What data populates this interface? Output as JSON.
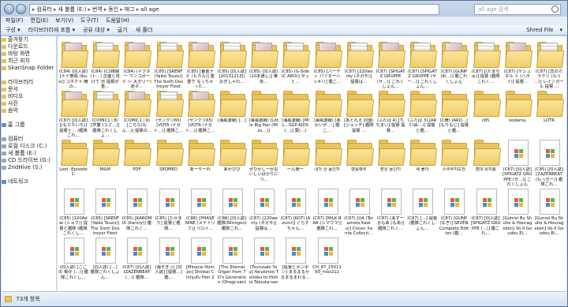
{
  "window": {
    "breadcrumb": [
      "컴퓨터",
      "새 볼륨 (E:)",
      "번역",
      "동인",
      "매그",
      "all age"
    ],
    "search_placeholder": "all age 검색"
  },
  "menu": [
    "파일(F)",
    "편집(E)",
    "보기(V)",
    "도구(T)",
    "도움말(H)"
  ],
  "toolbar": {
    "items": [
      "구성 ▾",
      "라이브러리에 포함 ▾",
      "공유 대상 ▾",
      "굽기",
      "새 폴더"
    ],
    "shred": "Shred File",
    "view": "▾"
  },
  "nav": [
    {
      "label": "즐겨찾기",
      "icon": "star"
    },
    {
      "label": "다운로드",
      "icon": "folder"
    },
    {
      "label": "바탕 화면",
      "icon": "folder"
    },
    {
      "label": "최근 위치",
      "icon": "folder"
    },
    {
      "label": "SkanSnap Folder",
      "icon": "folder"
    },
    {
      "label": "",
      "icon": ""
    },
    {
      "label": "라이브러리",
      "icon": "folder"
    },
    {
      "label": "문서",
      "icon": "folder"
    },
    {
      "label": "비디오",
      "icon": "folder"
    },
    {
      "label": "사진",
      "icon": "folder"
    },
    {
      "label": "음악",
      "icon": "folder"
    },
    {
      "label": "",
      "icon": ""
    },
    {
      "label": "홈 그룹",
      "icon": "net"
    },
    {
      "label": "",
      "icon": ""
    },
    {
      "label": "컴퓨터",
      "icon": "drive"
    },
    {
      "label": "로컬 디스크 (C:)",
      "icon": "drive"
    },
    {
      "label": "새 볼륨 (E:)",
      "icon": "drive"
    },
    {
      "label": "CD 드라이브 (G:)",
      "icon": "drive"
    },
    {
      "label": "2ndHive (S:)",
      "icon": "drive"
    },
    {
      "label": "",
      "icon": ""
    },
    {
      "label": "네트워크",
      "icon": "net"
    }
  ],
  "files": [
    {
      "name": "(C84) (同人誌) [ナイ巻情 (Ikue)] コネクト-俺の…",
      "kind": "folder",
      "paper": "tone"
    },
    {
      "name": "(C84) (C2楼閣 (ト…) 正面と背けて 日 提督が重…",
      "kind": "folder",
      "paper": "ink"
    },
    {
      "name": "(C84) (ドクター ウンコボーイ 〜 大ガリー) 迷子…",
      "kind": "folder",
      "paper": "tone"
    },
    {
      "name": "(C85) [SRENF (Yaikó Tsuzu)] The Sixth Destroyer Fleet",
      "kind": "folder",
      "paper": "ink"
    },
    {
      "name": "(C85) [番重ナビ (ヒカル)] 重重で なっちゃった…",
      "kind": "folder",
      "paper": "tone"
    },
    {
      "name": "(C85) [同人誌] [2013121日] おぎしゃれ…",
      "kind": "folder",
      "paper": "ink"
    },
    {
      "name": "(C85) (同人誌) (10本通し)] 東京…",
      "kind": "folder",
      "paper": "tone"
    },
    {
      "name": "(C85) (G-Side (C ARO)] ダッと…",
      "kind": "folder",
      "paper": "ink"
    },
    {
      "name": "(C85) [パーティ バツターハ ッキリ] 艦こ…",
      "kind": "folder",
      "paper": "tone"
    },
    {
      "name": "(C87) [220wenty (ネガモ)] 提督は…",
      "kind": "folder",
      "paper": "ink"
    },
    {
      "name": "(C87) [SPIGATZ GRUPPE (サ…)] これくしょん…",
      "kind": "folder",
      "paper": "tone"
    },
    {
      "name": "(C87) [SPIGATZ GRUPPE (サー…)] これくしょん…",
      "kind": "folder",
      "paper": "ink"
    },
    {
      "name": "(C87) [GUNP (Ki…)] 艦これくしょん",
      "kind": "folder",
      "paper": "tone"
    },
    {
      "name": "(C87) [(たまちゅ)] 提督 (艦隊これく…",
      "kind": "folder",
      "paper": "ink"
    },
    {
      "name": "(C87) [ゲシュタル ト (ハネイ)] 提督…",
      "kind": "folder",
      "paper": "tone"
    },
    {
      "name": "(C87) [恋のカラクリ (ルリ …)] レインガール 提督 …",
      "kind": "folder",
      "paper": "ink"
    },
    {
      "name": "(C87) [同人誌] [(もりたいち)] 提督と… (艦隊これ…",
      "kind": "folder",
      "paper": "tone"
    },
    {
      "name": "(COMIC1☆8) [学童 (ユズ…)] 艦隊これくしょ…",
      "kind": "folder",
      "paper": "ink"
    },
    {
      "name": "(COMIC1☆9) [こちら(もん…)] 提督の…",
      "kind": "folder",
      "paper": "tone"
    },
    {
      "name": "(サンクリ65) [VOTA (ナガト…)] 艦隊こ…",
      "kind": "folder",
      "paper": "ink"
    },
    {
      "name": "(サンクリ65) [VOTA (ナガト…)] 艦隊こ…",
      "kind": "folder",
      "paper": "tone"
    },
    {
      "name": "(海風激戦) […]",
      "kind": "folder",
      "paper": "none"
    },
    {
      "name": "(海風激戦) [Little Big Pair (Mizu…)]",
      "kind": "folder",
      "paper": "none"
    },
    {
      "name": "(海風激戦) [MIL…SGP-KIDS (…)] 愛(…)",
      "kind": "folder",
      "paper": "none"
    },
    {
      "name": "(海風激戦) [あかいが …] 艦こ…",
      "kind": "folder",
      "paper": "none"
    },
    {
      "name": "(あとれえ 同盟) [ジョッチ] 艦隊 提督 …",
      "kind": "folder",
      "paper": "none"
    },
    {
      "name": "(ふたば 4) [ちちまい] 提督 提督…",
      "kind": "folder",
      "paper": "none"
    },
    {
      "name": "(ふたば 3) [ARC(ぬ…)] 提督と艦…",
      "kind": "folder",
      "paper": "none"
    },
    {
      "name": "(C様) (ARO…) [もりもじ] 提督と艦…",
      "kind": "folder",
      "paper": "none"
    },
    {
      "name": "c85",
      "kind": "folder",
      "paper": "none"
    },
    {
      "name": "kodama",
      "kind": "folder",
      "paper": "none"
    },
    {
      "name": "LOTR",
      "kind": "folder",
      "paper": "none"
    },
    {
      "name": "Loot -Episode1-",
      "kind": "folder",
      "paper": "none"
    },
    {
      "name": "M&M",
      "kind": "folder",
      "paper": "none"
    },
    {
      "name": "PDF",
      "kind": "folder",
      "paper": "none"
    },
    {
      "name": "SEQMED",
      "kind": "folder",
      "paper": "none"
    },
    {
      "name": "あーやーれ",
      "kind": "folder",
      "paper": "none"
    },
    {
      "name": "あかびび",
      "kind": "folder",
      "paper": "none"
    },
    {
      "name": "ぜひかしーがおいしいばかりにつ…",
      "kind": "folder",
      "paper": "none"
    },
    {
      "name": "ーん使ー",
      "kind": "folder",
      "paper": "none"
    },
    {
      "name": "내가 산 동인지",
      "kind": "folder",
      "paper": "none"
    },
    {
      "name": "영웅해루",
      "kind": "folder",
      "paper": "none"
    },
    {
      "name": "받은 동인지",
      "kind": "folder",
      "paper": "none"
    },
    {
      "name": "새 폴더",
      "kind": "folder",
      "paper": "none"
    },
    {
      "name": "스쿠루지도전",
      "kind": "folder",
      "paper": "none"
    },
    {
      "name": "점대 유지됨",
      "kind": "folder",
      "paper": "none"
    },
    {
      "name": "(C87) [同人誌] [SPIGATZ GRUPPE (サ…)] これくしょん",
      "kind": "file"
    },
    {
      "name": "(C85) [同人誌] [ZAZENBEAT (もっちー)] 艦隊これ…",
      "kind": "file"
    },
    {
      "name": "(C85) [120Adat (ショウ)] 提督と艦隊 (艦隊これくし…",
      "kind": "file"
    },
    {
      "name": "(C85) [SRENF (Yaikó Tsuzu)] The Sixth Destroyer Fleet",
      "kind": "file"
    },
    {
      "name": "(C85) [KAROMIX (Karory)] 艦隊これく…",
      "kind": "file"
    },
    {
      "name": "(C85) [たかまり] 提督と艦隊…",
      "kind": "file"
    },
    {
      "name": "(C86) [PHASE NINE (メテトリフ)] リロイ…",
      "kind": "file"
    },
    {
      "name": "(C86) [同人誌] 艦隊(Nitrogen) 艦隊これ…",
      "kind": "file"
    },
    {
      "name": "(C87) [220wenty (ネガモ)] 提督は…",
      "kind": "file"
    },
    {
      "name": "(C87) [KOTI (Azumi)] ぐらすちゃん…",
      "kind": "file"
    },
    {
      "name": "(C87) [MILK BAR (シマウマ)] 艦隊これ…",
      "kind": "file"
    },
    {
      "name": "(C87) [UA (Teramoto Kaoru)] Clover Xanta Collecti…",
      "kind": "file"
    },
    {
      "name": "(C87) [あずーるもあ (もあ)] 艦隊これく…",
      "kind": "file"
    },
    {
      "name": "(C87) […] 提督 (艦隊これくしょん…",
      "kind": "file"
    },
    {
      "name": "(C87) [GUNP (なぎ)] SEVEN Complete Edition (艦…",
      "kind": "file"
    },
    {
      "name": "(C87) [同人誌] [SPIGATZ GRUPPE (…)] 艦これ…",
      "kind": "file"
    },
    {
      "name": "[Gunrei Bu Shuho & Hourageken] Vo-ll Goudou Ei…",
      "kind": "file"
    },
    {
      "name": "[Gunrei Bu Shuho & Hourageken] Vo-ll Goudou Ei…",
      "kind": "file"
    },
    {
      "name": "(同人誌) [ここの 帳仔 (…)] 艦隊これくし…",
      "kind": "file"
    },
    {
      "name": "(同人誌) […] 艦隊これくしょん…",
      "kind": "file"
    },
    {
      "name": "(C87) [同人誌] (ZAZENBEAT (…)) 艦隊…",
      "kind": "file"
    },
    {
      "name": "(海そきっ) [同人誌] [提督…] 艦…",
      "kind": "file"
    },
    {
      "name": "[Minarai Hompo] Shinkai Chinjufu Hen 2",
      "kind": "file"
    },
    {
      "name": "[The Eternal Organ from 7D's Generation (Ohagi-san) Sa…",
      "kind": "file"
    },
    {
      "name": "[Tsurusaki Yuu] Yarukinee Teitoku to Hishio Tatsuta-san Kai…",
      "kind": "file"
    },
    {
      "name": "[提督とボンボン] まるまるかるまるまわる…",
      "kind": "file"
    },
    {
      "name": "CH_87_1501190_moz212",
      "kind": "file"
    }
  ],
  "status": {
    "count_text": "73개 항목"
  }
}
